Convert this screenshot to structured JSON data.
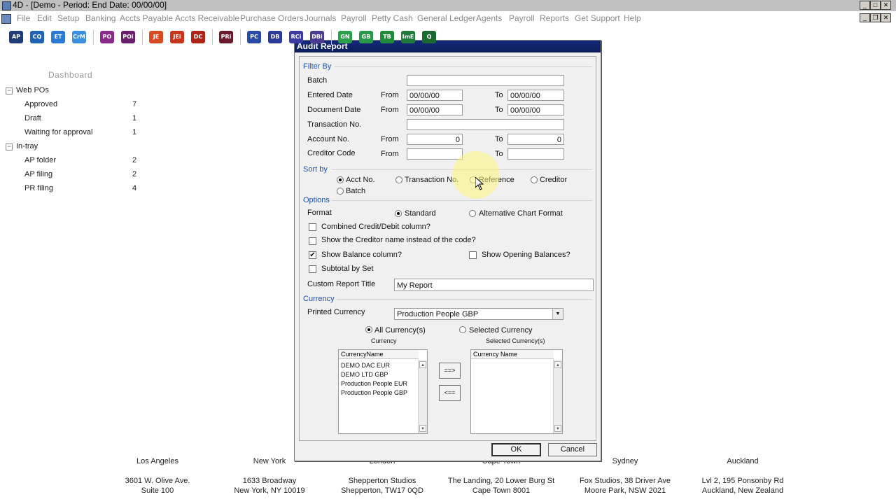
{
  "window": {
    "title": "4D - [Demo - Period: End Date: 00/00/00]"
  },
  "menu": [
    "File",
    "Edit",
    "Setup",
    "Banking",
    "Accts Payable",
    "Accts Receivable",
    "Purchase Orders",
    "Journals",
    "Payroll",
    "Petty Cash",
    "General Ledger",
    "Agents",
    "Payroll",
    "Reports",
    "Get Support",
    "Help"
  ],
  "toolbar": [
    {
      "label": "AP",
      "color": "#1f3b78"
    },
    {
      "label": "CQ",
      "color": "#1f64b4"
    },
    {
      "label": "ET",
      "color": "#2a7ad6"
    },
    {
      "label": "CrM",
      "color": "#3a8fe0"
    },
    {
      "label": "PO",
      "color": "#8c2a8c"
    },
    {
      "label": "POi",
      "color": "#6a1f6a"
    },
    {
      "label": "JE",
      "color": "#d84a22"
    },
    {
      "label": "JEi",
      "color": "#c8341c"
    },
    {
      "label": "DC",
      "color": "#b02418"
    },
    {
      "label": "PRi",
      "color": "#6a1a2a"
    },
    {
      "label": "PC",
      "color": "#2a4aa8"
    },
    {
      "label": "DB",
      "color": "#2a3a98"
    },
    {
      "label": "RCi",
      "color": "#3a3aa0"
    },
    {
      "label": "DBi",
      "color": "#4a3a90"
    },
    {
      "label": "GN",
      "color": "#2aa04a"
    },
    {
      "label": "GB",
      "color": "#28984a"
    },
    {
      "label": "TB",
      "color": "#1f8a3a"
    },
    {
      "label": "ImE",
      "color": "#1f7a3a"
    },
    {
      "label": "Q",
      "color": "#1a6a30"
    }
  ],
  "dashboard": {
    "title": "Dashboard",
    "groups": [
      {
        "label": "Web POs",
        "toggle": "−",
        "items": [
          {
            "label": "Approved",
            "count": "7"
          },
          {
            "label": "Draft",
            "count": "1"
          },
          {
            "label": "Waiting for approval",
            "count": "1"
          }
        ]
      },
      {
        "label": "In-tray",
        "toggle": "−",
        "items": [
          {
            "label": "AP folder",
            "count": "2"
          },
          {
            "label": "AP filing",
            "count": "2"
          },
          {
            "label": "PR filing",
            "count": "4"
          }
        ]
      }
    ]
  },
  "dialog": {
    "title": "Audit Report",
    "filter": {
      "section": "Filter By",
      "batch_label": "Batch",
      "batch_value": "",
      "entered_label": "Entered Date",
      "entered_from": "00/00/00",
      "entered_to": "00/00/00",
      "document_label": "Document Date",
      "document_from": "00/00/00",
      "document_to": "00/00/00",
      "transaction_label": "Transaction No.",
      "transaction_value": "",
      "account_label": "Account No.",
      "account_from": "0",
      "account_to": "0",
      "creditor_label": "Creditor Code",
      "creditor_from": "",
      "creditor_to": "",
      "from_label": "From",
      "to_label": "To"
    },
    "sort": {
      "section": "Sort by",
      "options": [
        "Acct No.",
        "Transaction No.",
        "Reference",
        "Creditor",
        "Batch"
      ],
      "selected": "Acct No."
    },
    "options": {
      "section": "Options",
      "format_label": "Format",
      "format_standard": "Standard",
      "format_alt": "Alternative Chart Format",
      "combined": "Combined Credit/Debit column?",
      "show_creditor_name": "Show the Creditor name instead of the code?",
      "show_balance": "Show Balance column?",
      "show_opening": "Show Opening Balances?",
      "subtotal": "Subtotal by Set",
      "check_mark": "✔",
      "custom_title_label": "Custom Report Title",
      "custom_title_value": "My Report"
    },
    "currency": {
      "section": "Currency",
      "printed_label": "Printed Currency",
      "printed_value": "Production People GBP",
      "all_label": "All Currency(s)",
      "selected_label": "Selected Currency",
      "left_caption": "Currency",
      "right_caption": "Selected Currency(s)",
      "left_header": "CurrencyName",
      "right_header": "Currency Name",
      "left_items": [
        "DEMO DAC EUR",
        "DEMO LTD GBP",
        "Production People EUR",
        "Production People GBP"
      ],
      "add_button": "==>",
      "remove_button": "<=="
    },
    "ok_label": "OK",
    "cancel_label": "Cancel"
  },
  "offices": [
    {
      "city": "Los Angeles",
      "line1": "3601 W. Olive Ave.",
      "line2": "Suite 100"
    },
    {
      "city": "New York",
      "line1": "1633 Broadway",
      "line2": "New York, NY 10019"
    },
    {
      "city": "London",
      "line1": "Shepperton Studios",
      "line2": "Shepperton, TW17 0QD"
    },
    {
      "city": "Cape Town",
      "line1": "The Landing, 20 Lower Burg St",
      "line2": "Cape Town 8001"
    },
    {
      "city": "Sydney",
      "line1": "Fox Studios, 38 Driver Ave",
      "line2": "Moore Park, NSW 2021"
    },
    {
      "city": "Auckland",
      "line1": "Lvl 2, 195 Ponsonby Rd",
      "line2": "Auckland, New Zealand"
    }
  ]
}
